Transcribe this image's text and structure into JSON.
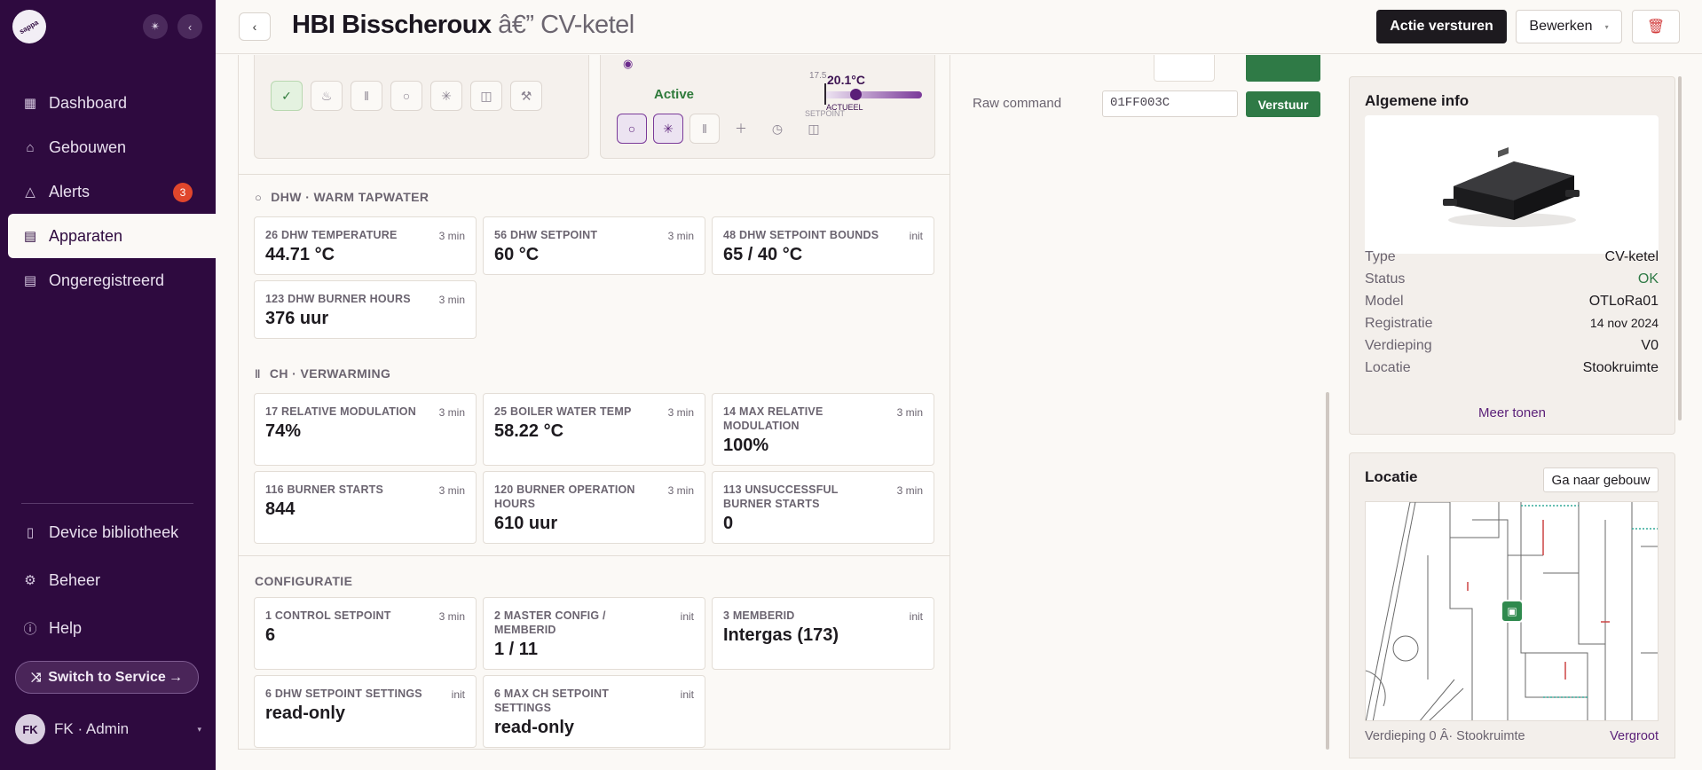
{
  "sidebar": {
    "logo_text": "sappa",
    "nav": [
      {
        "label": "Dashboard",
        "icon": "grid-icon"
      },
      {
        "label": "Gebouwen",
        "icon": "home-icon"
      },
      {
        "label": "Alerts",
        "icon": "alert-triangle-icon",
        "badge": "3"
      },
      {
        "label": "Apparaten",
        "icon": "device-list-icon",
        "active": true
      },
      {
        "label": "Ongeregistreerd",
        "icon": "device-list-icon"
      }
    ],
    "nav_bottom": [
      {
        "label": "Device bibliotheek",
        "icon": "book-icon"
      },
      {
        "label": "Beheer",
        "icon": "gear-icon"
      },
      {
        "label": "Help",
        "icon": "help-circle-icon"
      }
    ],
    "switch_label": "Switch to Service →",
    "user": {
      "initials": "FK",
      "name": "FK · Admin"
    }
  },
  "header": {
    "title": "HBI Bisscheroux",
    "title_suffix": "â€” CV-ketel",
    "actions": {
      "primary": "Actie versturen",
      "edit": "Bewerken"
    }
  },
  "thermostat": {
    "status": "Active",
    "current_temp": "20.1°C",
    "temp_cut": "17.5",
    "label_actueel": "ACTUEEL",
    "label_setpoint": "SETPOINT"
  },
  "sections": {
    "dhw": {
      "title": "DHW · WARM TAPWATER",
      "tiles": [
        {
          "label": "26 DHW TEMPERATURE",
          "age": "3 min",
          "value": "44.71 °C"
        },
        {
          "label": "56 DHW SETPOINT",
          "age": "3 min",
          "value": "60 °C"
        },
        {
          "label": "48 DHW SETPOINT BOUNDS",
          "age": "init",
          "value": "65 / 40 °C"
        },
        {
          "label": "123 DHW BURNER HOURS",
          "age": "3 min",
          "value": "376 uur"
        }
      ]
    },
    "ch": {
      "title": "CH · VERWARMING",
      "tiles": [
        {
          "label": "17 RELATIVE MODULATION",
          "age": "3 min",
          "value": "74%"
        },
        {
          "label": "25 BOILER WATER TEMP",
          "age": "3 min",
          "value": "58.22 °C"
        },
        {
          "label": "14 MAX RELATIVE MODULATION",
          "age": "3 min",
          "value": "100%"
        },
        {
          "label": "116 BURNER STARTS",
          "age": "3 min",
          "value": "844"
        },
        {
          "label": "120 BURNER OPERATION HOURS",
          "age": "3 min",
          "value": "610 uur"
        },
        {
          "label": "113 UNSUCCESSFUL BURNER STARTS",
          "age": "3 min",
          "value": "0"
        }
      ]
    },
    "config": {
      "title": "CONFIGURATIE",
      "tiles": [
        {
          "label": "1 CONTROL SETPOINT",
          "age": "3 min",
          "value": "6"
        },
        {
          "label": "2 MASTER CONFIG / MEMBERID",
          "age": "init",
          "value": "1 / 11"
        },
        {
          "label": "3 MEMBERID",
          "age": "init",
          "value": "Intergas (173)"
        },
        {
          "label": "6 DHW SETPOINT SETTINGS",
          "age": "init",
          "value": "read-only"
        },
        {
          "label": "6 MAX CH SETPOINT SETTINGS",
          "age": "init",
          "value": "read-only"
        }
      ]
    }
  },
  "raw_command": {
    "label": "Raw command",
    "value": "01FF003C",
    "button": "Verstuur"
  },
  "info": {
    "title": "Algemene info",
    "rows": [
      {
        "key": "Type",
        "value": "CV-ketel"
      },
      {
        "key": "Status",
        "value": "OK"
      },
      {
        "key": "Model",
        "value": "OTLoRa01"
      },
      {
        "key": "Registratie",
        "value": "14 nov 2024"
      },
      {
        "key": "Verdieping",
        "value": "V0"
      },
      {
        "key": "Locatie",
        "value": "Stookruimte"
      }
    ],
    "more": "Meer tonen"
  },
  "location": {
    "title": "Locatie",
    "button": "Ga naar gebouw",
    "footer": "Verdieping 0 Â· Stookruimte",
    "enlarge": "Vergroot"
  },
  "colors": {
    "sidebar": "#2e0a3f",
    "accent": "#5a1f78",
    "success": "#2f7a46",
    "badge": "#e0462c"
  }
}
